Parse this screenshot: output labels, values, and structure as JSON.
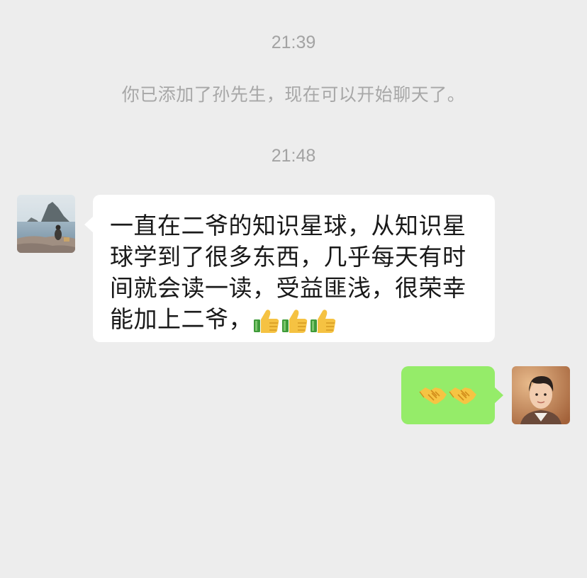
{
  "chat": {
    "messages": [
      {
        "type": "timestamp",
        "text": "21:39"
      },
      {
        "type": "system",
        "text": "你已添加了孙先生，现在可以开始聊天了。"
      },
      {
        "type": "timestamp",
        "text": "21:48"
      },
      {
        "type": "incoming",
        "sender_avatar": "landscape-photo-avatar",
        "text": "一直在二爷的知识星球，从知识星球学到了很多东西，几乎每天有时间就会读一读，受益匪浅，很荣幸能加上二爷，",
        "emojis": [
          "thumbs-up-icon",
          "thumbs-up-icon",
          "thumbs-up-icon"
        ]
      },
      {
        "type": "outgoing",
        "sender_avatar": "portrait-photo-avatar",
        "emojis": [
          "handshake-icon",
          "handshake-icon"
        ]
      }
    ]
  },
  "colors": {
    "background": "#ededed",
    "incoming_bubble": "#ffffff",
    "outgoing_bubble": "#95ec69",
    "meta_text": "#a3a3a3",
    "message_text": "#191919"
  }
}
